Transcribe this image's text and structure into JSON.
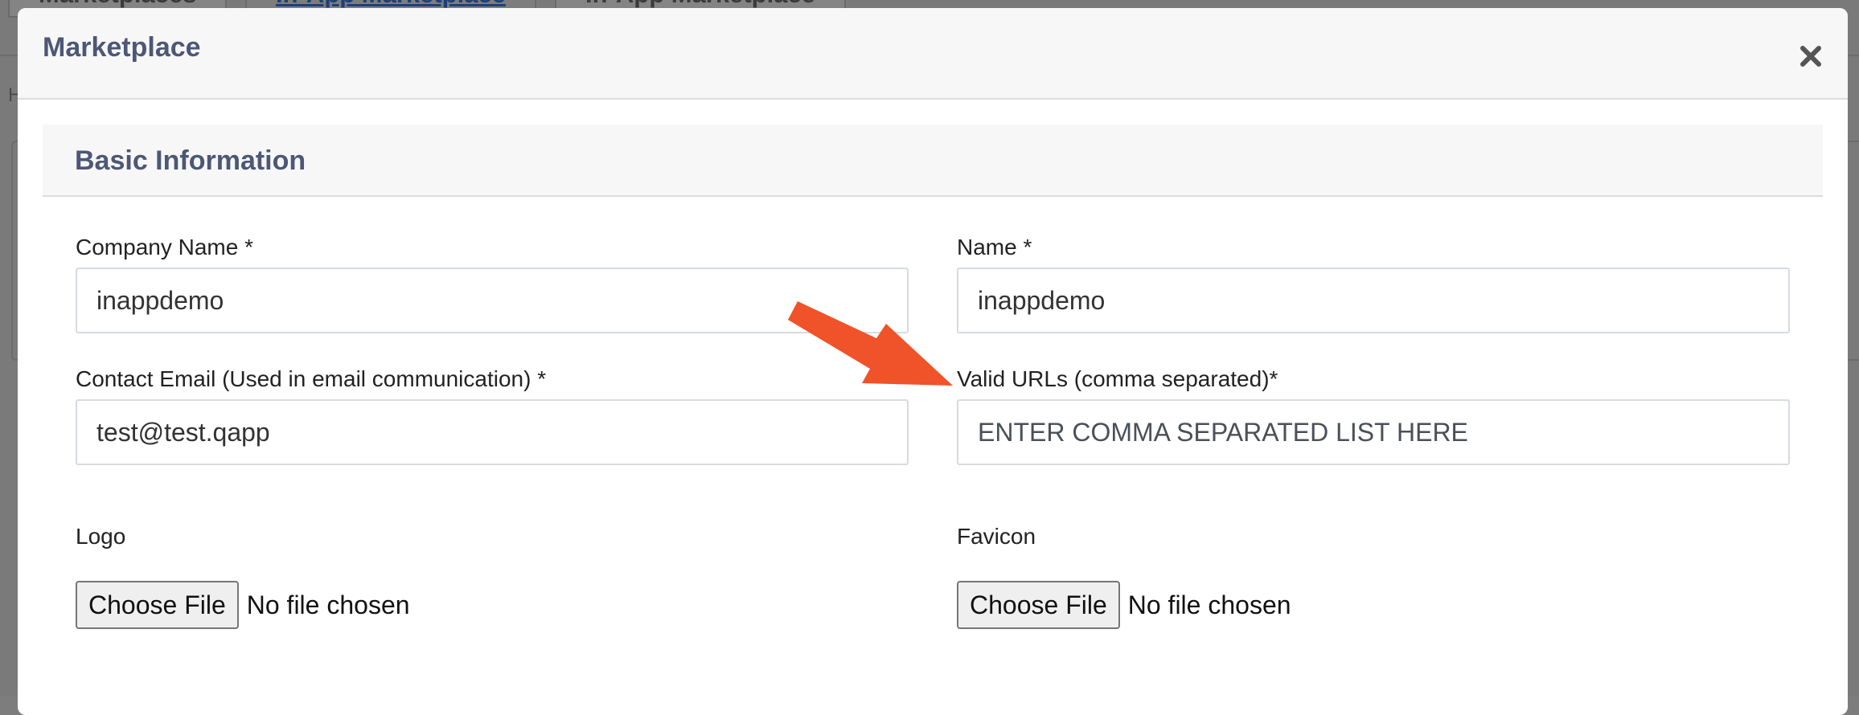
{
  "background": {
    "tabs": [
      "Marketplaces",
      "In-App Marketplace",
      "In-App Marketplace"
    ],
    "side_letter": "H"
  },
  "modal": {
    "title": "Marketplace",
    "close_icon": "close-icon",
    "section_title": "Basic Information",
    "fields": {
      "company_name": {
        "label": "Company Name *",
        "value": "inappdemo"
      },
      "name": {
        "label": "Name *",
        "value": "inappdemo"
      },
      "contact_email": {
        "label": "Contact Email (Used in email communication) *",
        "value": "test@test.qapp"
      },
      "valid_urls": {
        "label": "Valid URLs (comma separated)*",
        "value": "",
        "placeholder": "ENTER COMMA SEPARATED LIST HERE"
      },
      "logo": {
        "label": "Logo",
        "button": "Choose File",
        "status": "No file chosen"
      },
      "favicon": {
        "label": "Favicon",
        "button": "Choose File",
        "status": "No file chosen"
      }
    }
  },
  "annotation": {
    "icon": "arrow-icon",
    "color": "#f0522a"
  },
  "colors": {
    "heading": "#4d5776",
    "header_bg": "#f7f7f7",
    "overlay": "#7d7d7d"
  }
}
